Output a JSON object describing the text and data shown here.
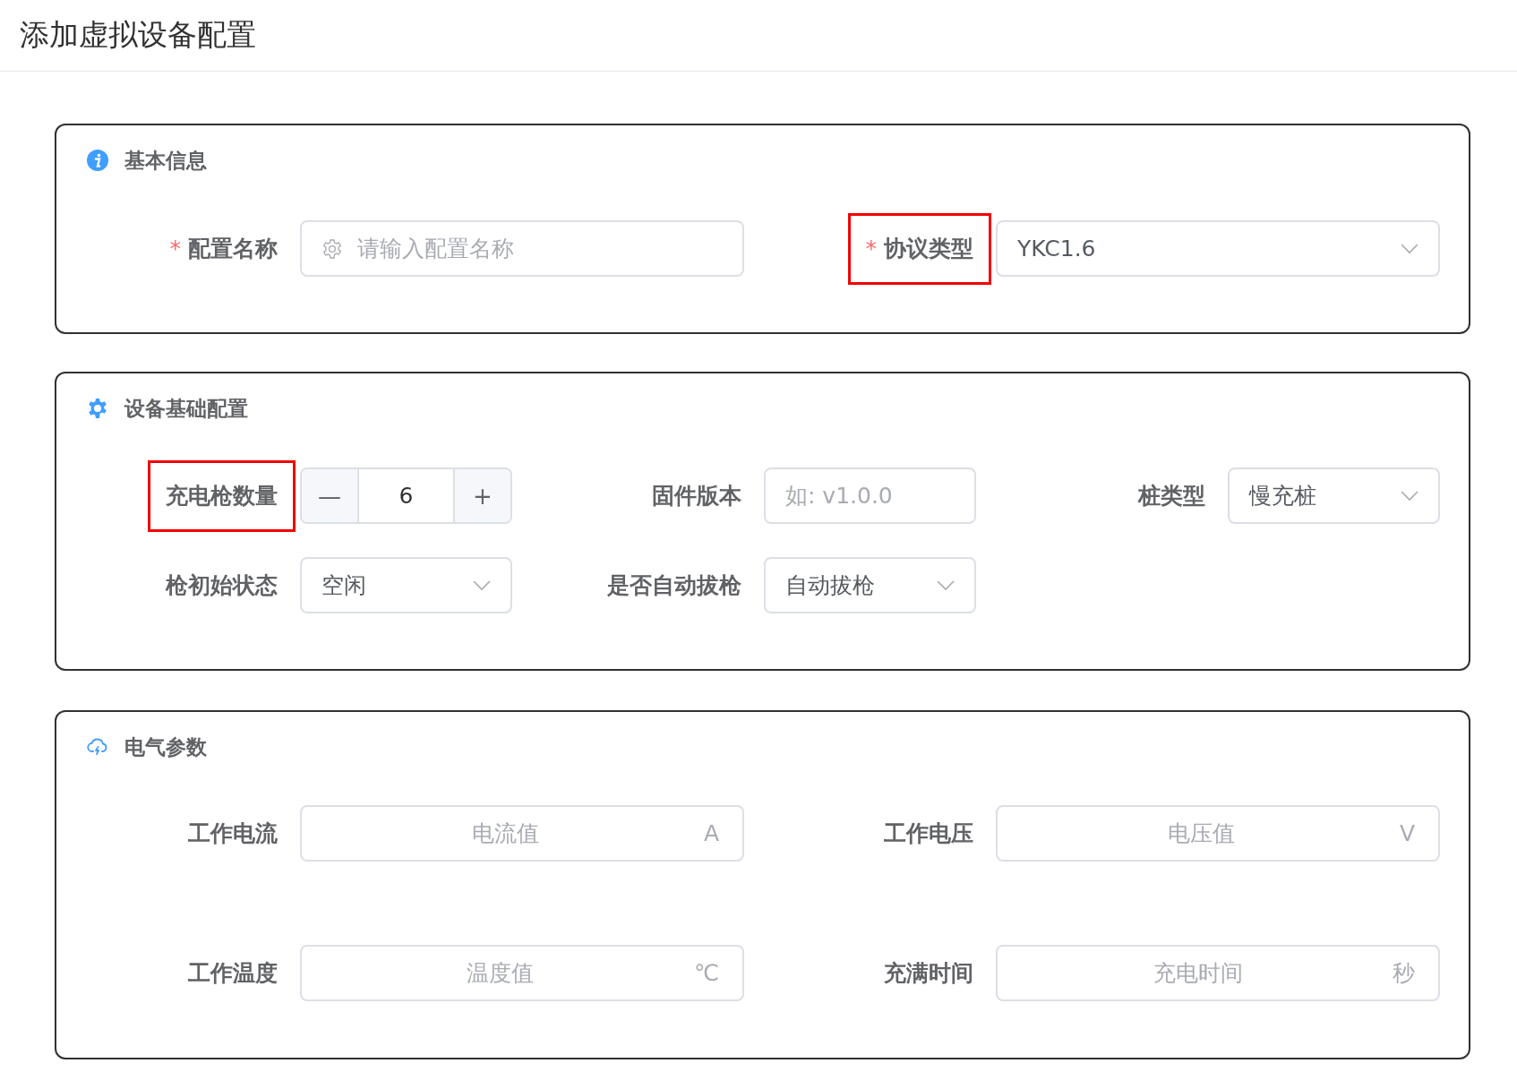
{
  "title": "添加虚拟设备配置",
  "sections": [
    {
      "title": "基本信息",
      "rows": [
        [
          {
            "kind": "icon-input",
            "label": "配置名称",
            "required": true,
            "required_mark": "*",
            "highlighted": false,
            "placeholder": "请输入配置名称"
          },
          {
            "kind": "select",
            "label": "协议类型",
            "required": true,
            "required_mark": "*",
            "highlighted": true,
            "value": "YKC1.6"
          }
        ]
      ]
    },
    {
      "title": "设备基础配置",
      "rows": [
        [
          {
            "kind": "stepper",
            "label": "充电枪数量",
            "required": false,
            "highlighted": true,
            "value": "6",
            "minus": "—",
            "plus": "+"
          },
          {
            "kind": "text",
            "label": "固件版本",
            "required": false,
            "highlighted": false,
            "placeholder": "如: v1.0.0"
          },
          {
            "kind": "select",
            "label": "桩类型",
            "required": false,
            "highlighted": false,
            "value": "慢充桩"
          }
        ],
        [
          {
            "kind": "select",
            "label": "枪初始状态",
            "required": false,
            "highlighted": false,
            "value": "空闲"
          },
          {
            "kind": "select",
            "label": "是否自动拔枪",
            "required": false,
            "highlighted": false,
            "value": "自动拔枪"
          }
        ]
      ]
    },
    {
      "title": "电气参数",
      "rows": [
        [
          {
            "kind": "unit-input",
            "label": "工作电流",
            "required": false,
            "highlighted": false,
            "placeholder": "电流值",
            "unit": "A"
          },
          {
            "kind": "unit-input",
            "label": "工作电压",
            "required": false,
            "highlighted": false,
            "placeholder": "电压值",
            "unit": "V"
          }
        ],
        [
          {
            "kind": "unit-input",
            "label": "工作温度",
            "required": false,
            "highlighted": false,
            "placeholder": "温度值",
            "unit": "℃"
          },
          {
            "kind": "unit-input",
            "label": "充满时间",
            "required": false,
            "highlighted": false,
            "placeholder": "充电时间",
            "unit": "秒"
          }
        ]
      ]
    }
  ]
}
